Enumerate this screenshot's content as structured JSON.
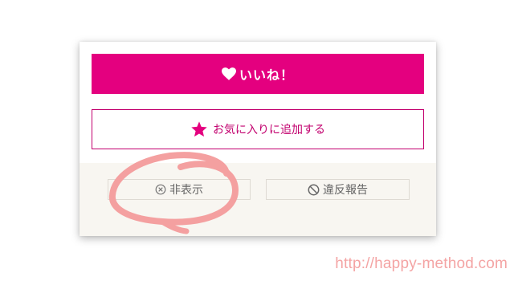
{
  "like_button": {
    "label": "いいね！",
    "icon": "heart-icon"
  },
  "favorite_button": {
    "label": "お気に入りに追加する",
    "icon": "star-icon"
  },
  "hide_button": {
    "label": "非表示",
    "icon": "circle-x-icon"
  },
  "report_button": {
    "label": "違反報告",
    "icon": "prohibited-icon"
  },
  "watermark": {
    "text": "http://happy-method.com"
  },
  "colors": {
    "brand": "#e4007f",
    "favorite_border": "#c2006e",
    "footer_bg": "#f8f6f1",
    "annotation": "#f4a0a0"
  }
}
